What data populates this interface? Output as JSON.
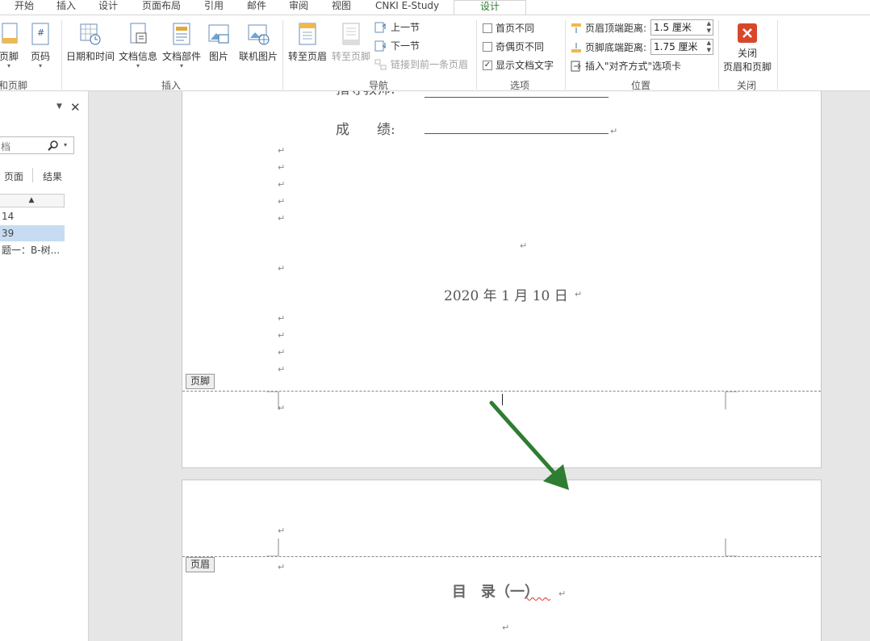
{
  "tabs": [
    "开始",
    "插入",
    "设计",
    "页面布局",
    "引用",
    "邮件",
    "审阅",
    "视图",
    "CNKI E-Study",
    "设计"
  ],
  "ribbon": {
    "group_hf_label": "和页脚",
    "btn_footer": "页脚",
    "btn_pagenum": "页码",
    "btn_datetime": "日期和时间",
    "btn_docinfo": "文档信息",
    "btn_docparts": "文档部件",
    "btn_picture": "图片",
    "btn_onlinepic": "联机图片",
    "group_insert_label": "插入",
    "btn_goto_header": "转至页眉",
    "btn_goto_footer": "转至页脚",
    "btn_prev": "上一节",
    "btn_next": "下一节",
    "btn_link_prev": "链接到前一条页眉",
    "group_nav_label": "导航",
    "opt_first_page": "首页不同",
    "opt_odd_even": "奇偶页不同",
    "opt_show_text": "显示文档文字",
    "group_options_label": "选项",
    "header_top_label": "页眉顶端距离:",
    "header_top_value": "1.5 厘米",
    "footer_bottom_label": "页脚底端距离:",
    "footer_bottom_value": "1.75 厘米",
    "insert_align_tab": "插入\"对齐方式\"选项卡",
    "group_position_label": "位置",
    "close_line1": "关闭",
    "close_line2": "页眉和页脚",
    "group_close_label": "关闭"
  },
  "nav": {
    "search_placeholder": "档",
    "tab_pages": "页面",
    "tab_results": "结果",
    "items": [
      "14",
      "39",
      "题一：B-树..."
    ]
  },
  "doc": {
    "partial_line": "指导教师:",
    "score_label": "成　　绩:",
    "date": "2020 年 1 月 10 日",
    "footer_tag": "页脚",
    "header_tag": "页眉",
    "toc_title": "目　录（一）"
  },
  "colors": {
    "accent": "#2b7a2b",
    "arrow": "#2e7d32",
    "close_btn": "#d9472b"
  }
}
